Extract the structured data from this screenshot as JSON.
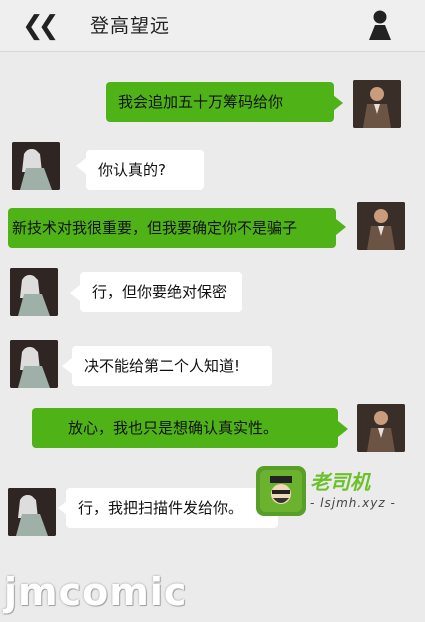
{
  "header": {
    "back_icon": "double-chevron-left-icon",
    "title": "登高望远",
    "profile_icon": "person-icon"
  },
  "messages": [
    {
      "side": "right",
      "text": "我会追加五十万筹码给你"
    },
    {
      "side": "left",
      "text": "你认真的?"
    },
    {
      "side": "right",
      "text": "新技术对我很重要，但我要确定你不是骗子"
    },
    {
      "side": "left",
      "text": "行，但你要绝对保密"
    },
    {
      "side": "left",
      "text": "决不能给第二个人知道!"
    },
    {
      "side": "right",
      "text": "放心，我也只是想确认真实性。"
    },
    {
      "side": "left",
      "text": "行，我把扫描件发给你。"
    }
  ],
  "watermarks": {
    "site_name": "老司机",
    "site_url": "- lsjmh.xyz -",
    "brand": "jmcomic"
  },
  "colors": {
    "sent_bubble": "#4fb318",
    "received_bubble": "#ffffff",
    "background": "#ebebeb"
  }
}
